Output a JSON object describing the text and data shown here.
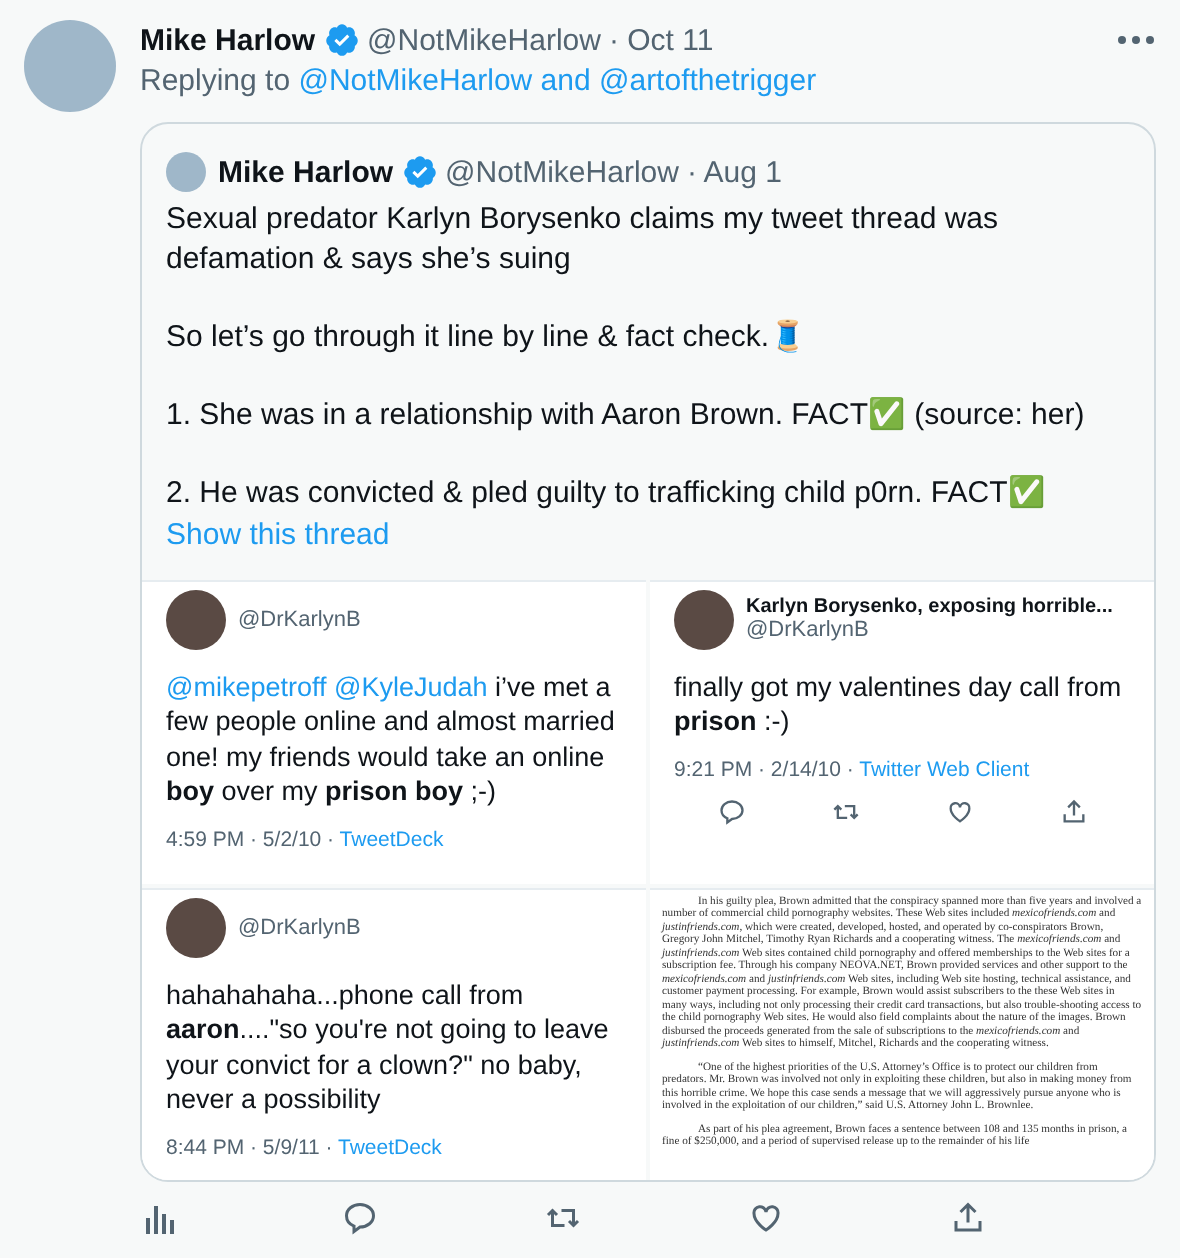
{
  "tweet": {
    "name": "Mike Harlow",
    "verified": true,
    "handle": "@NotMikeHarlow",
    "date": "· Oct 11",
    "reply_prefix": "Replying to",
    "reply_to": "@NotMikeHarlow and @artofthetrigger"
  },
  "quoted": {
    "name": "Mike Harlow",
    "verified": true,
    "handle": "@NotMikeHarlow",
    "date": "· Aug 1",
    "paragraphs": [
      "Sexual predator Karlyn Borysenko claims my tweet thread was defamation & says she’s suing",
      "So let’s go through it line by line & fact check.🧵",
      "1. She was in a relationship with Aaron Brown. FACT✅ (source: her)",
      "2. He was convicted & pled guilty to trafficking child p0rn. FACT✅"
    ],
    "show_thread": "Show this thread",
    "images": [
      {
        "kind": "tweet",
        "handle": "@DrKarlynB",
        "mentions": "@mikepetroff @KyleJudah",
        "text": "i’ve met a few people online and almost married one! my friends would take an online **boy** over my **prison boy** ;-)",
        "time": "4:59 PM · 5/2/10 ·",
        "source": "TweetDeck"
      },
      {
        "kind": "tweet",
        "name": "Karlyn Borysenko, exposing horrible...",
        "handle": "@DrKarlynB",
        "text": "finally got my valentines day call from **prison** :-)",
        "time": "9:21 PM · 2/14/10 ·",
        "source": "Twitter Web Client",
        "actions": true
      },
      {
        "kind": "tweet",
        "handle": "@DrKarlynB",
        "text": "hahahahaha...phone call from **aaron**....\"so you're not going to leave your convict for a clown?\" no baby, never a possibility",
        "time": "8:44 PM · 5/9/11 ·",
        "source": "TweetDeck"
      },
      {
        "kind": "document",
        "paragraphs": [
          "In his guilty plea, Brown admitted that the conspiracy spanned more than five years and involved a number of commercial child pornography websites. These Web sites included *mexicofriends.com* and *justinfriends.com*, which were created, developed, hosted, and operated by co-conspirators Brown, Gregory John Mitchel, Timothy Ryan Richards and a cooperating witness. The *mexicofriends.com* and *justinfriends.com* Web sites contained child pornography and offered memberships to the Web sites for a subscription fee. Through his company NEOVA.NET, Brown provided services and other support to the *mexicofriends.com* and *justinfriends.com* Web sites, including Web site hosting, technical assistance, and customer payment processing. For example, Brown would assist subscribers to the these Web sites in many ways, including not only processing their credit card transactions, but also trouble-shooting access to the child pornography Web sites. He would also field complaints about the nature of the images. Brown disbursed the proceeds generated from the sale of subscriptions to the *mexicofriends.com* and *justinfriends.com* Web sites to himself, Mitchel, Richards and the cooperating witness.",
          "“One of the highest priorities of the U.S. Attorney’s Office is to protect our children from predators. Mr. Brown was involved not only in exploiting these children, but also in making money from this horrible crime. We hope this case sends a message that we will aggressively pursue anyone who is involved in the exploitation of our children,” said U.S. Attorney John L. Brownlee.",
          "As part of his plea agreement, Brown faces a sentence between 108 and 135 months in prison, a fine of $250,000, and a period of supervised release up to the remainder of his life"
        ]
      }
    ]
  }
}
